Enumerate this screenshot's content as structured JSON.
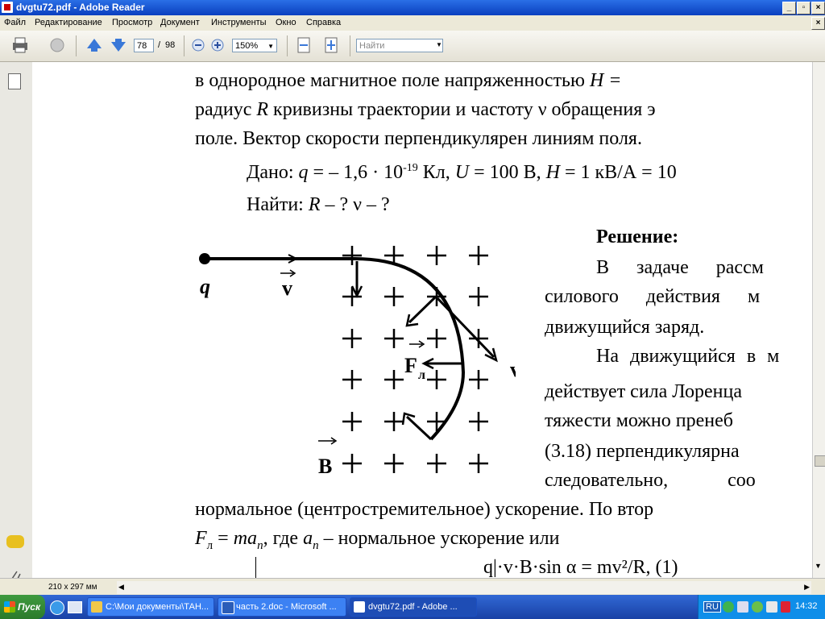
{
  "window": {
    "title": "dvgtu72.pdf - Adobe Reader"
  },
  "menu": [
    "Файл",
    "Редактирование",
    "Просмотр",
    "Документ",
    "Инструменты",
    "Окно",
    "Справка"
  ],
  "toolbar": {
    "page_current": "78",
    "page_sep": "/",
    "page_total": "98",
    "zoom": "150%",
    "search_placeholder": "Найти"
  },
  "document": {
    "line1": "в однородное магнитное поле напряженностью",
    "line1_var": "H =",
    "line2a": "радиус",
    "line2_var": "R",
    "line2b": "кривизны траектории и частоту ν обращения э",
    "line3": "поле. Вектор скорости перпендикулярен линиям поля.",
    "given_label": "Дано:",
    "given_q": "q",
    "given_q_val": "= – 1,6 · 10",
    "given_q_exp": "-19",
    "given_rest1": "Кл,",
    "given_u": "U",
    "given_rest2": "= 100 В,",
    "given_h": "H",
    "given_rest3": "= 1 кВ/А = 10",
    "find_label": "Найти:",
    "find_r": "R",
    "find_rest": "– ?  ν – ?",
    "solution_title": "Решение:",
    "sol_line1": "В задаче рассм",
    "sol_line2": "силового действия м",
    "sol_line3": "движущийся заряд.",
    "sol_line4": "На движущийся в м",
    "sol_line5": "действует сила Лоренца",
    "sol_line6": "тяжести можно пренеб",
    "sol_line7": "(3.18) перпендикулярна",
    "sol_line8": "следовательно, соо",
    "full_line1": "нормальное (центростремительное) ускорение. По втор",
    "full_line2_f": "F",
    "full_line2_sub": "л",
    "full_line2_mid": "=",
    "full_line2_ma": "ma",
    "full_line2_n": "n",
    "full_line2_rest1": ", где",
    "full_line2_an": "a",
    "full_line2_n2": "n",
    "full_line2_rest2": "– нормальное ускорение или",
    "formula": "q|·v·B·sin α = mv²/R, (1)",
    "fig_q": "q",
    "fig_v1": "v",
    "fig_v2": "v",
    "fig_f": "F",
    "fig_f_sub": "л",
    "fig_b": "B"
  },
  "status": {
    "page_size": "210 x 297 мм"
  },
  "taskbar": {
    "start": "Пуск",
    "tasks": [
      "C:\\Мои документы\\ТАН...",
      "часть 2.doc - Microsoft ...",
      "dvgtu72.pdf - Adobe ..."
    ],
    "lang": "RU",
    "clock": "14:32"
  },
  "colors": {
    "accent": "#0a3fbf",
    "start": "#2b7a2b"
  }
}
